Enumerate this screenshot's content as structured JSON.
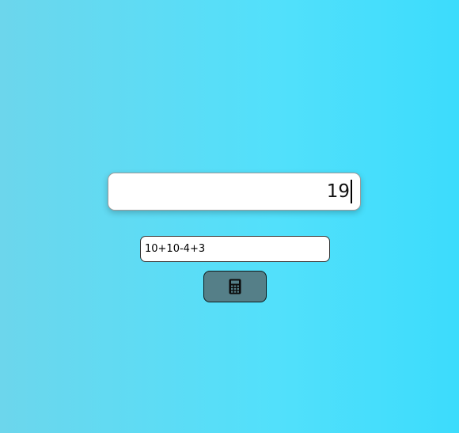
{
  "display": {
    "value": "19"
  },
  "expression_input": {
    "value": "10+10-4+3"
  },
  "calculate_button": {
    "icon": "calculator-icon",
    "icon_color": "#0b0b0b",
    "background": "#557f88"
  }
}
